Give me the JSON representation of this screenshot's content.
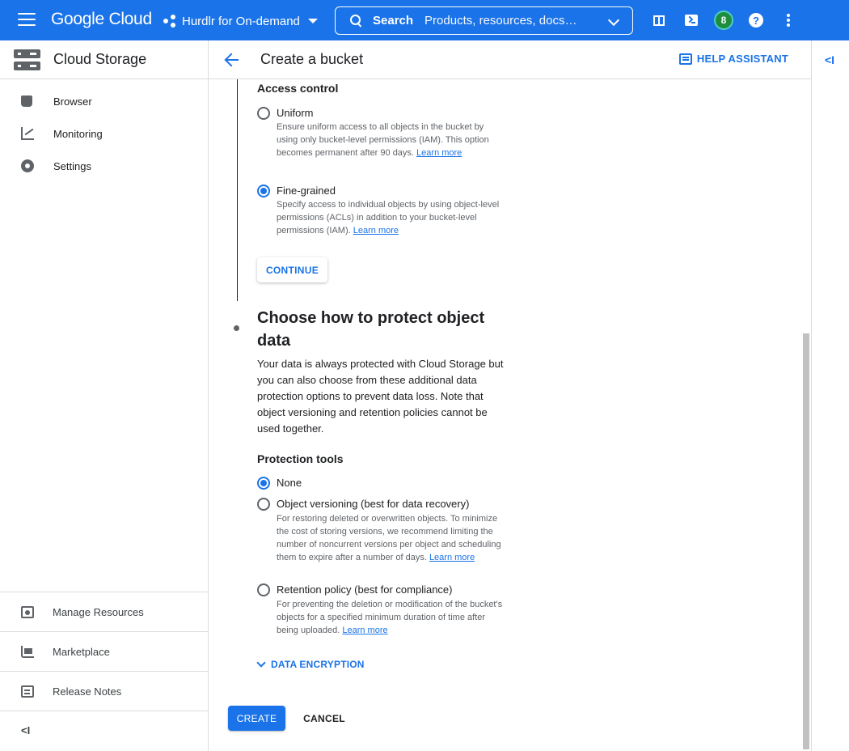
{
  "topbar": {
    "logo": "Google Cloud",
    "project": "Hurdlr for On-demand",
    "search_label": "Search",
    "search_placeholder": "Products, resources, docs…",
    "badge_count": "8",
    "help_glyph": "?"
  },
  "sidebar": {
    "title": "Cloud Storage",
    "items": [
      {
        "label": "Browser",
        "icon": "bucket-icon"
      },
      {
        "label": "Monitoring",
        "icon": "monitoring-icon"
      },
      {
        "label": "Settings",
        "icon": "gear-icon"
      }
    ],
    "bottom_items": [
      {
        "label": "Manage Resources",
        "icon": "manage-resources-icon"
      },
      {
        "label": "Marketplace",
        "icon": "cart-icon"
      },
      {
        "label": "Release Notes",
        "icon": "release-notes-icon"
      }
    ],
    "collapse_glyph": "<I"
  },
  "header": {
    "title": "Create a bucket",
    "help_assistant": "HELP ASSISTANT",
    "panel_toggle_glyph": "<I"
  },
  "access_control": {
    "heading": "Access control",
    "options": [
      {
        "label": "Uniform",
        "selected": false,
        "description": "Ensure uniform access to all objects in the bucket by using only bucket-level permissions (IAM). This option becomes permanent after 90 days.",
        "link": "Learn more"
      },
      {
        "label": "Fine-grained",
        "selected": true,
        "description": "Specify access to individual objects by using object-level permissions (ACLs) in addition to your bucket-level permissions (IAM).",
        "link": "Learn more"
      }
    ],
    "continue_label": "CONTINUE"
  },
  "protection": {
    "heading": "Choose how to protect object data",
    "description": "Your data is always protected with Cloud Storage but you can also choose from these additional data protection options to prevent data loss. Note that object versioning and retention policies cannot be used together.",
    "tools_heading": "Protection tools",
    "options": [
      {
        "label": "None",
        "selected": true,
        "description": "",
        "link": ""
      },
      {
        "label": "Object versioning (best for data recovery)",
        "selected": false,
        "description": "For restoring deleted or overwritten objects. To minimize the cost of storing versions, we recommend limiting the number of noncurrent versions per object and scheduling them to expire after a number of days.",
        "link": "Learn more"
      },
      {
        "label": "Retention policy (best for compliance)",
        "selected": false,
        "description": "For preventing the deletion or modification of the bucket's objects for a specified minimum duration of time after being uploaded.",
        "link": "Learn more"
      }
    ],
    "encryption_label": "DATA ENCRYPTION"
  },
  "actions": {
    "create_label": "CREATE",
    "cancel_label": "CANCEL"
  },
  "colors": {
    "accent": "#1a73e8",
    "topbar": "#1a73e8",
    "badge": "#1e8e3e"
  }
}
